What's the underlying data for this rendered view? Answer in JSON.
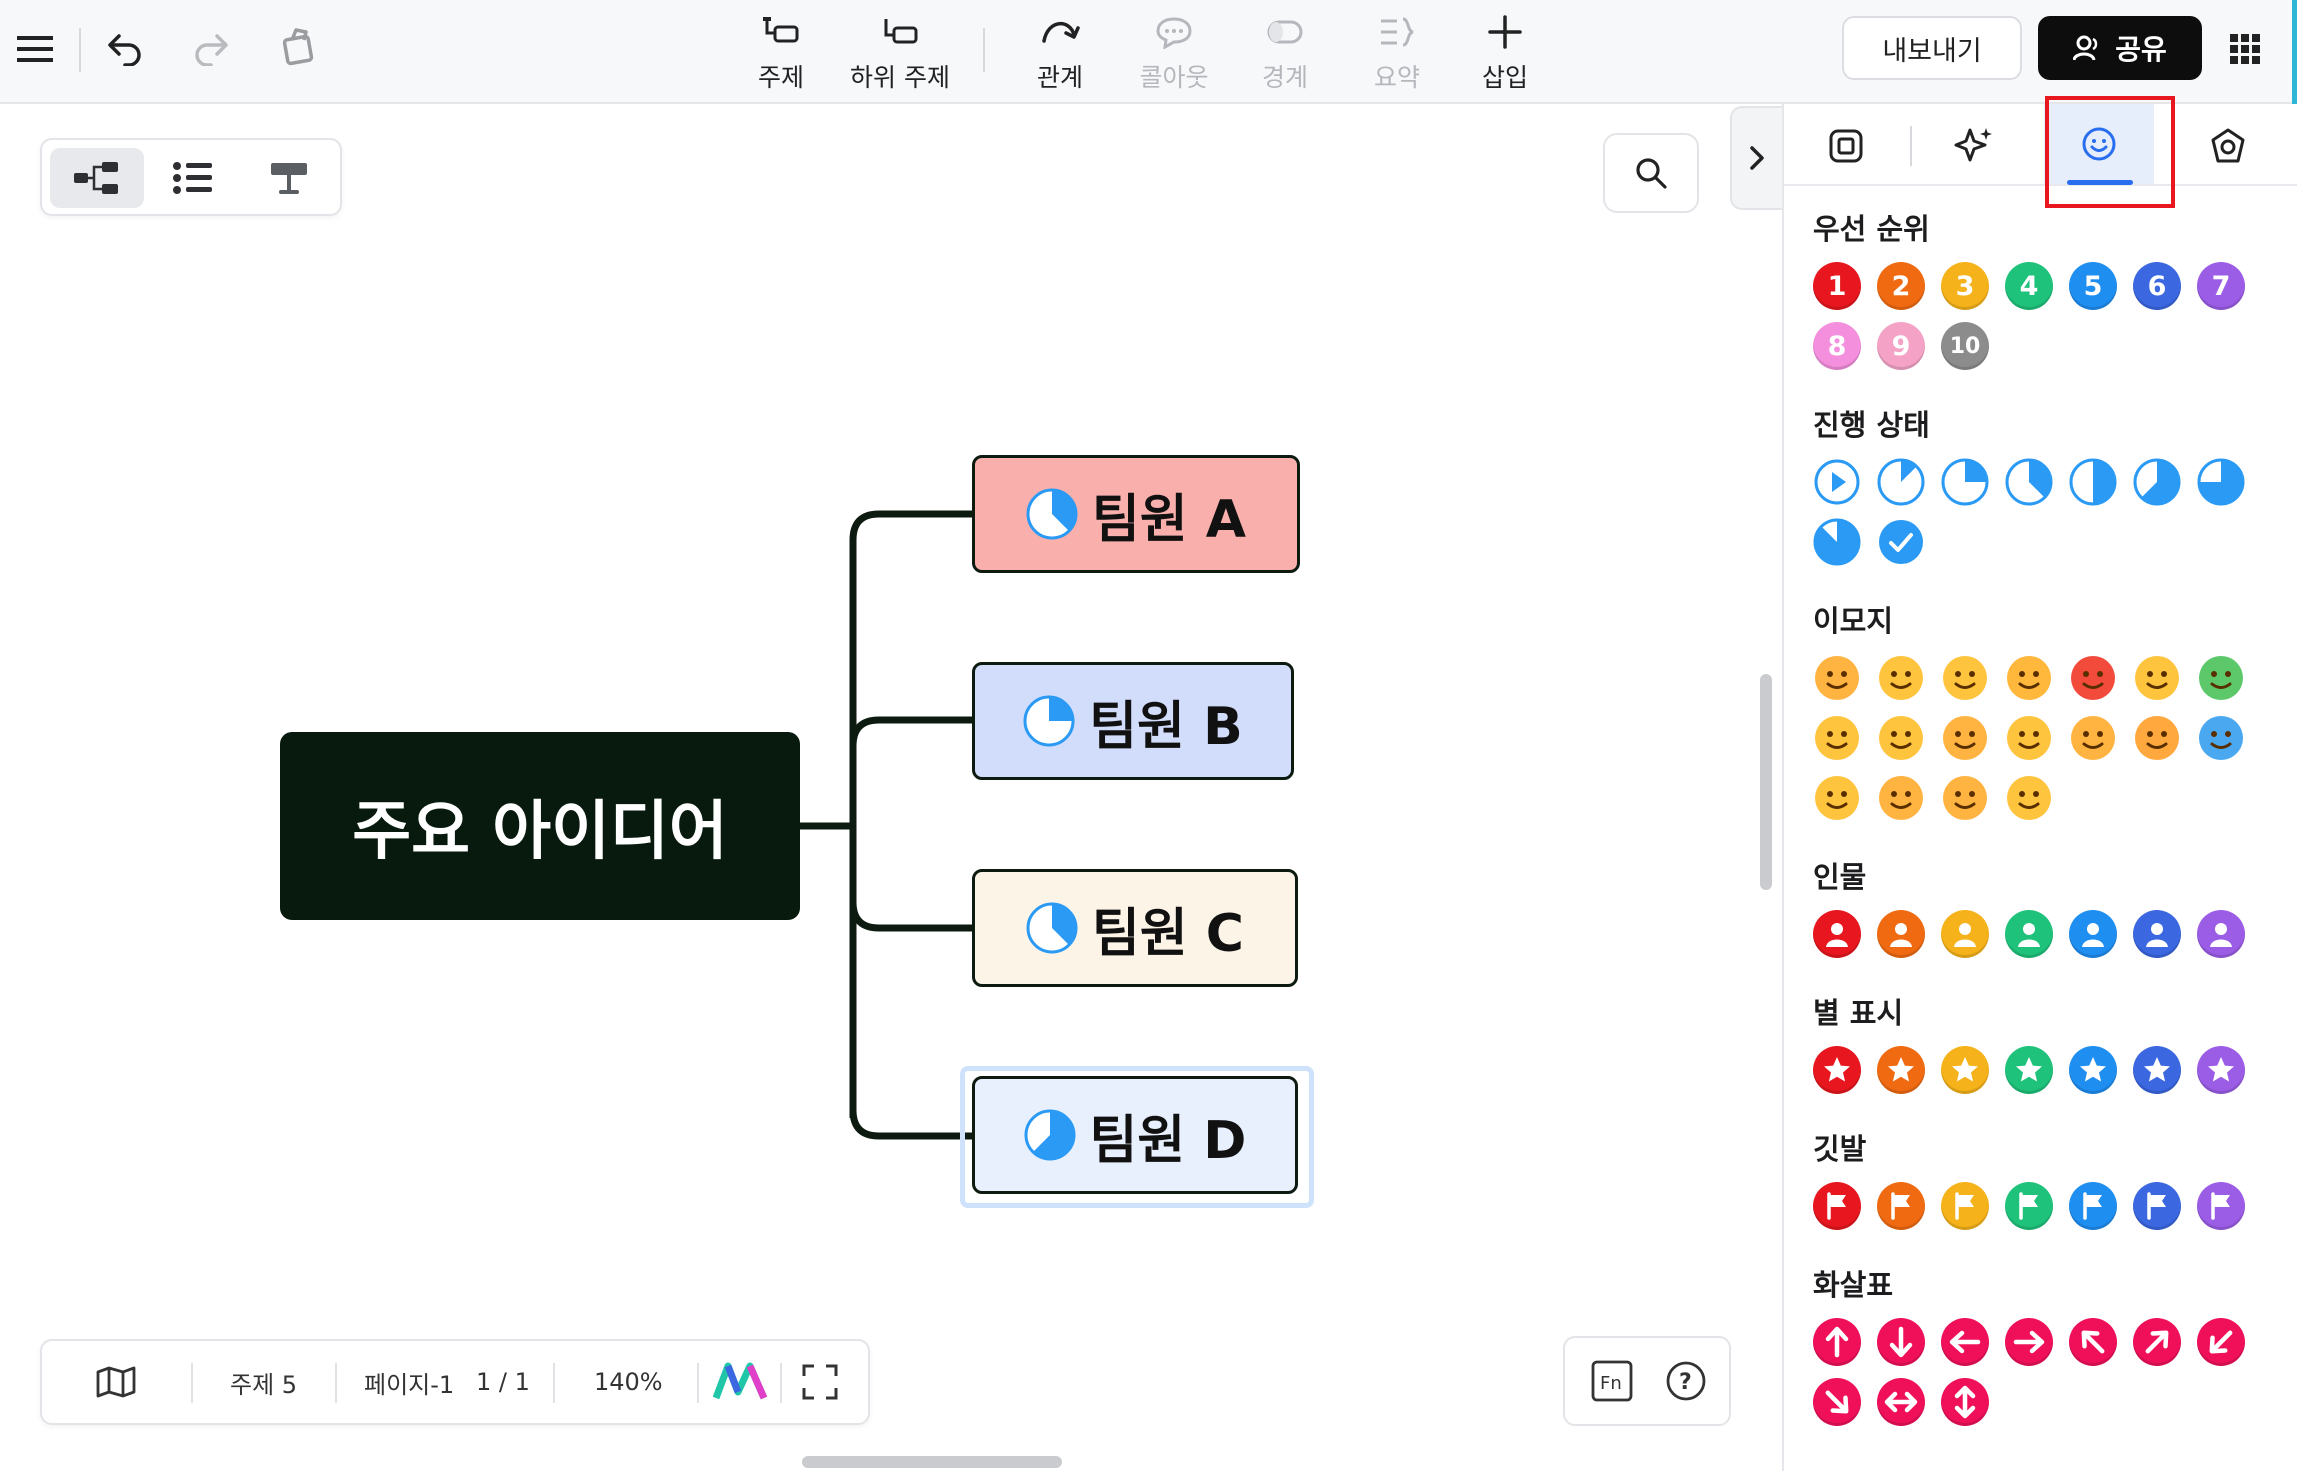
{
  "toolbar": {
    "tools": [
      {
        "label": "주제",
        "icon": "topic-icon",
        "enabled": true
      },
      {
        "label": "하위 주제",
        "icon": "subtopic-icon",
        "enabled": true
      },
      {
        "label": "관계",
        "icon": "relationship-icon",
        "enabled": true
      },
      {
        "label": "콜아웃",
        "icon": "callout-icon",
        "enabled": false
      },
      {
        "label": "경계",
        "icon": "boundary-icon",
        "enabled": false
      },
      {
        "label": "요약",
        "icon": "summary-icon",
        "enabled": false
      },
      {
        "label": "삽입",
        "icon": "plus-icon",
        "enabled": true
      }
    ],
    "export_label": "내보내기",
    "share_label": "공유"
  },
  "mindmap": {
    "root": "주요 아이디어",
    "children": [
      {
        "label": "팀원 A",
        "fill": "#f9b0ad",
        "progress": 0.375
      },
      {
        "label": "팀원 B",
        "fill": "#d2dcfb",
        "progress": 0.25
      },
      {
        "label": "팀원 C",
        "fill": "#fdf4e8",
        "progress": 0.375
      },
      {
        "label": "팀원 D",
        "fill": "#e8f0fd",
        "progress": 0.625
      }
    ]
  },
  "status_bar": {
    "topic_count": "주제 5",
    "page_label": "페이지-1",
    "page_count": "1 / 1",
    "zoom": "140%"
  },
  "panel": {
    "tabs": [
      "style-icon",
      "ai-sparkle-icon",
      "marker-icon",
      "theme-icon"
    ],
    "active_tab": "marker-icon",
    "sections": {
      "priority": {
        "title": "우선 순위",
        "items": [
          "1",
          "2",
          "3",
          "4",
          "5",
          "6",
          "7",
          "8",
          "9",
          "10"
        ],
        "colors": [
          "#e8161e",
          "#f06a12",
          "#f5b21a",
          "#1ec27a",
          "#1e8ef0",
          "#3b67e0",
          "#9b5de5",
          "#f48fdd",
          "#f4a3c6",
          "#8c8c8c"
        ]
      },
      "progress": {
        "title": "진행 상태",
        "items": [
          "start",
          "12.5%",
          "25%",
          "37.5%",
          "50%",
          "62.5%",
          "75%",
          "87.5%",
          "done"
        ]
      },
      "emoji": {
        "title": "이모지",
        "items": [
          "laugh",
          "smile",
          "nerd",
          "sad",
          "angry",
          "cry",
          "sick",
          "shock",
          "grin",
          "tongue",
          "glasses",
          "cool",
          "love",
          "freeze",
          "mask",
          "think",
          "sleepy",
          "meh"
        ]
      },
      "people": {
        "title": "인물",
        "colors": [
          "#e8161e",
          "#f06a12",
          "#f5b21a",
          "#1ec27a",
          "#1e8ef0",
          "#3b67e0",
          "#9b5de5"
        ]
      },
      "stars": {
        "title": "별 표시",
        "colors": [
          "#e8161e",
          "#f06a12",
          "#f5b21a",
          "#1ec27a",
          "#1e8ef0",
          "#3b67e0",
          "#9b5de5"
        ]
      },
      "flags": {
        "title": "깃발",
        "colors": [
          "#e8161e",
          "#f06a12",
          "#f5b21a",
          "#1ec27a",
          "#1e8ef0",
          "#3b67e0",
          "#9b5de5"
        ]
      },
      "arrows": {
        "title": "화살표",
        "items": [
          "up",
          "down",
          "left",
          "right",
          "up-left",
          "up-right",
          "down-left",
          "down-right",
          "left-right",
          "up-down"
        ],
        "color": "#f0105a"
      }
    }
  },
  "colors": {
    "accent": "#2a6ef0",
    "progress_blue": "#2a9af5",
    "highlight": "#e8161e",
    "root_fill": "#071a0d"
  }
}
